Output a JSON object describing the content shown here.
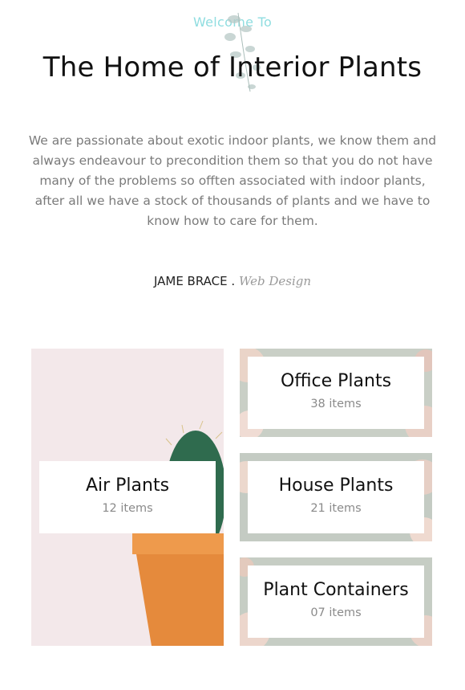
{
  "hero": {
    "eyebrow": "Welcome To",
    "title": "The Home of Interior Plants",
    "intro": "We are passionate about exotic indoor plants, we know them and always endeavour to precondition them so that you do not have many of the problems so offten associated with indoor plants, after all we have a stock of thousands of plants and we have to know how to care for them.",
    "author_name": "JAME BRACE .",
    "author_role": "Web Design"
  },
  "categories": [
    {
      "name": "Air Plants",
      "count": "12 items"
    },
    {
      "name": "Office Plants",
      "count": "38 items"
    },
    {
      "name": "House Plants",
      "count": "21 items"
    },
    {
      "name": "Plant Containers",
      "count": "07 items"
    }
  ],
  "colors": {
    "accent": "#8fdde0",
    "title": "#111111",
    "body_text": "#7a7a7a",
    "air_bg": "#f3e8ea",
    "pot": "#e58a3c",
    "cactus": "#2f6b4e"
  }
}
